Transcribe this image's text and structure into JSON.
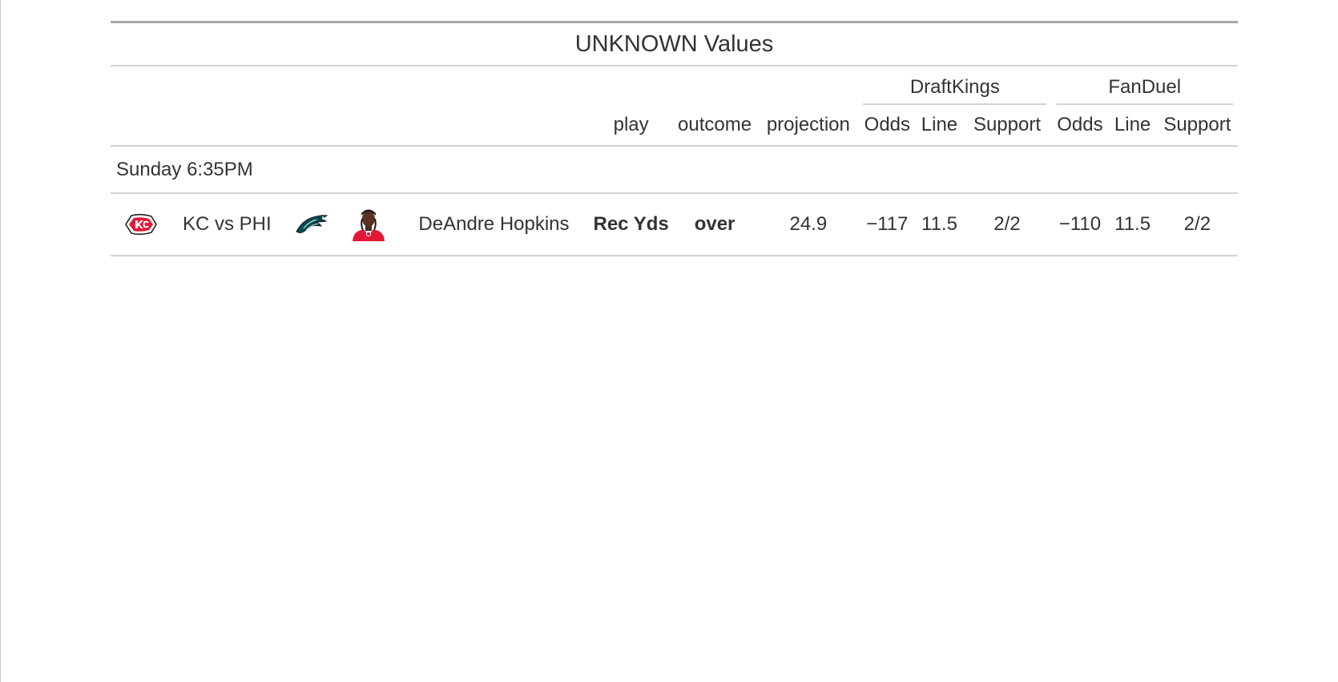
{
  "table": {
    "title": "UNKNOWN Values",
    "spanners": {
      "draftkings": "DraftKings",
      "fanduel": "FanDuel"
    },
    "columns": {
      "play": "play",
      "outcome": "outcome",
      "projection": "projection",
      "dk_odds": "Odds",
      "dk_line": "Line",
      "dk_support": "Support",
      "fd_odds": "Odds",
      "fd_line": "Line",
      "fd_support": "Support"
    },
    "group_label": "Sunday 6:35PM",
    "rows": [
      {
        "team_logo_icon": "chiefs-logo-icon",
        "matchup": "KC vs PHI",
        "opponent_logo_icon": "eagles-logo-icon",
        "player_headshot": "player-headshot-icon",
        "player": "DeAndre Hopkins",
        "play": "Rec Yds",
        "outcome": "over",
        "projection": "24.9",
        "dk_odds": "−117",
        "dk_line": "11.5",
        "dk_support": "2/2",
        "fd_odds": "−110",
        "fd_line": "11.5",
        "fd_support": "2/2"
      }
    ]
  },
  "colors": {
    "text": "#333333",
    "rule_strong": "#a8a8a8",
    "rule_light": "#d3d3d3",
    "chiefs_red": "#e31837",
    "eagles_green": "#004c54"
  }
}
